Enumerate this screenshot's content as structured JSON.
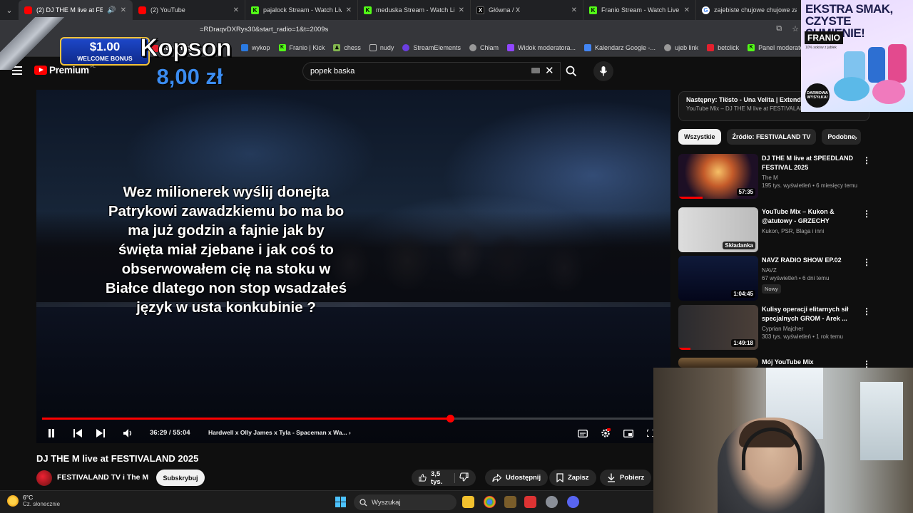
{
  "browser": {
    "tabs": [
      {
        "label": "(2) DJ THE M live at FESTIV",
        "favicon": "youtube-icon",
        "active": true
      },
      {
        "label": "(2) YouTube",
        "favicon": "youtube-icon",
        "active": false
      },
      {
        "label": "pajalock Stream - Watch Live o",
        "favicon": "kick-icon",
        "active": false
      },
      {
        "label": "meduska Stream - Watch Live o",
        "favicon": "kick-icon",
        "active": false
      },
      {
        "label": "Główna / X",
        "favicon": "x-icon",
        "active": false
      },
      {
        "label": "Franio Stream - Watch Live on",
        "favicon": "kick-icon",
        "active": false
      },
      {
        "label": "zajebiste chujowe chujowe zaje",
        "favicon": "google-icon",
        "active": false
      }
    ],
    "address": "=RDraqvDXRys30&start_radio=1&t=2009s",
    "bookmarks": [
      {
        "label": "wykop",
        "icon": "wykop-icon"
      },
      {
        "label": "Franio | Kick",
        "icon": "kick-icon"
      },
      {
        "label": "chess",
        "icon": "chess-icon"
      },
      {
        "label": "nudy",
        "icon": "folder-icon"
      },
      {
        "label": "StreamElements",
        "icon": "streamelements-icon"
      },
      {
        "label": "Chłam",
        "icon": "globe-icon"
      },
      {
        "label": "Widok moderatora...",
        "icon": "twitch-icon"
      },
      {
        "label": "Kalendarz Google -...",
        "icon": "calendar-icon"
      },
      {
        "label": "ujeb link",
        "icon": "globe-icon"
      },
      {
        "label": "betclick",
        "icon": "betclic-icon"
      },
      {
        "label": "Panel moderatora |...",
        "icon": "kick-icon"
      }
    ]
  },
  "youtube": {
    "logo_text": "Premium",
    "logo_region": "PL",
    "search_value": "popek baska"
  },
  "overlay": {
    "casehug_amount": "$1.00",
    "casehug_bonus": "WELCOME BONUS",
    "casehug_brand": "CaseHug",
    "donor_name": "Kopson",
    "donation_amount": "8,00 zł",
    "donation_message": "Wez milionerek wyślij donejta Patrykowi zawadzkiemu bo ma bo ma już godzin a fajnie jak by święta miał zjebane i jak coś to obserwowałem cię na stoku w Białce dlatego non stop wsadzałeś język w usta konkubinie ?"
  },
  "player": {
    "progress": 0.659,
    "time_display": "36:29 / 55:04",
    "chapter": "Hardwell x Olly James x Tyla - Spaceman x Wa...",
    "colors": {
      "progress": "#ff0000"
    }
  },
  "video": {
    "title": "DJ THE M live at FESTIVALAND 2025",
    "channel": "FESTIVALAND TV i The M",
    "subscribe_label": "Subskrybuj",
    "likes": "3,5 tys.",
    "share_label": "Udostępnij",
    "save_label": "Zapisz",
    "download_label": "Pobierz"
  },
  "sidebar": {
    "next_up_title": "Następny: Tiësto - Una Velita | Extended",
    "next_up_sub": "YouTube Mix – DJ THE M live at FESTIVALAND 2025",
    "chips": [
      "Wszystkie",
      "Źródło: FESTIVALAND TV",
      "Podobne"
    ],
    "videos": [
      {
        "title": "DJ THE M live at SPEEDLAND FESTIVAL 2025",
        "channel": "The M",
        "stats": "195 tys. wyświetleń • 6 miesięcy temu",
        "duration": "57:35",
        "badge": "",
        "watched": 0.3
      },
      {
        "title": "YouTube Mix – Kukon & @atutowy - GRZECHY",
        "channel": "Kukon, PSR, Blaga i inni",
        "stats": "",
        "duration": "Składanka",
        "badge": "",
        "watched": 0
      },
      {
        "title": "NAVZ RADIO SHOW EP.02",
        "channel": "NAVZ",
        "stats": "67 wyświetleń • 6 dni temu",
        "duration": "1:04:45",
        "badge": "Nowy",
        "watched": 0
      },
      {
        "title": "Kulisy operacji elitarnych sił specjalnych GROM - Arek ...",
        "channel": "Cyprian Majcher",
        "stats": "303 tys. wyświetleń • 1 rok temu",
        "duration": "1:49:18",
        "badge": "",
        "watched": 0.15
      },
      {
        "title": "Mój YouTube Mix",
        "channel": "",
        "stats": "",
        "duration": "",
        "badge": "",
        "watched": 0
      }
    ]
  },
  "ad": {
    "headline": "EKSTRA SMAK, CZYSTE SUMIENIE!",
    "brand": "FRANIO",
    "brand_sub": "10% soków z jabłek",
    "badge": "DARMOWA WYSYŁKA!"
  },
  "taskbar": {
    "temp": "6°C",
    "weather": "Cz. słonecznie",
    "search_label": "Wyszukaj"
  }
}
